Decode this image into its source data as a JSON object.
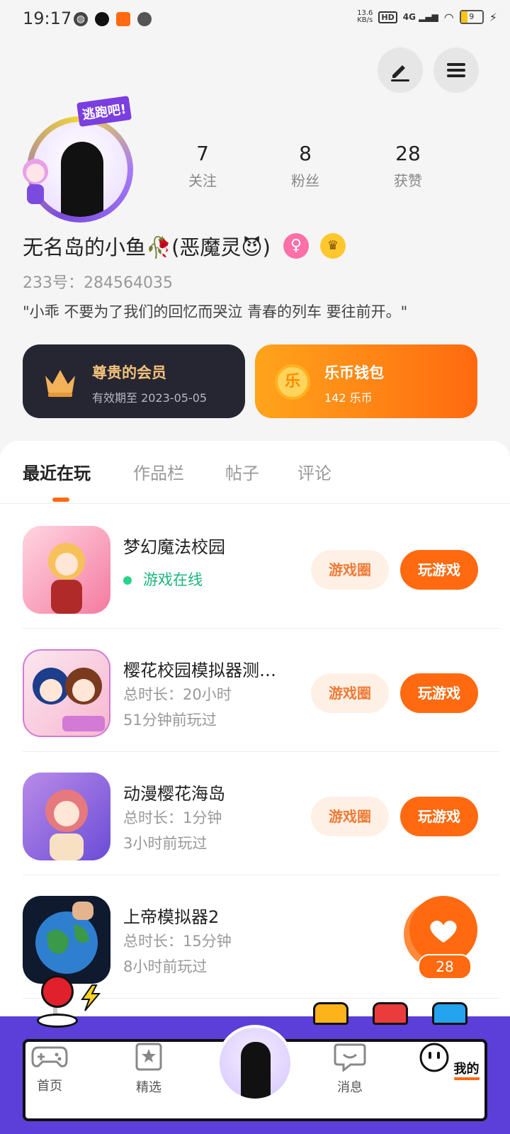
{
  "status_bar": {
    "time": "19:17",
    "net_speed": "13.6",
    "net_unit": "KB/s",
    "hd": "HD",
    "signal": "4G",
    "battery": "9"
  },
  "profile": {
    "badge_text": "逃跑吧!",
    "nickname": "无名岛的小鱼🥀(恶魔灵😈)",
    "uid_label": "233号：284564035",
    "signature": "\"小乖  不要为了我们的回忆而哭泣  青春的列车  要往前开。\"",
    "stats": [
      {
        "value": "7",
        "label": "关注"
      },
      {
        "value": "8",
        "label": "粉丝"
      },
      {
        "value": "28",
        "label": "获赞"
      }
    ]
  },
  "cards": {
    "vip": {
      "title": "尊贵的会员",
      "subtitle": "有效期至  2023-05-05"
    },
    "wallet": {
      "icon_char": "乐",
      "title": "乐币钱包",
      "subtitle": "142  乐币"
    }
  },
  "tabs": [
    "最近在玩",
    "作品栏",
    "帖子",
    "评论"
  ],
  "games": [
    {
      "name": "梦幻魔法校园",
      "line1": "游戏在线",
      "line2": "",
      "circle_label": "游戏圈",
      "play_label": "玩游戏"
    },
    {
      "name": "樱花校园模拟器测…",
      "line1": "总时长：20小时",
      "line2": "51分钟前玩过",
      "circle_label": "游戏圈",
      "play_label": "玩游戏"
    },
    {
      "name": "动漫樱花海岛",
      "line1": "总时长：1分钟",
      "line2": "3小时前玩过",
      "circle_label": "游戏圈",
      "play_label": "玩游戏"
    },
    {
      "name": "上帝模拟器2",
      "line1": "总时长：15分钟",
      "line2": "8小时前玩过"
    }
  ],
  "like_count": "28",
  "nav": {
    "home": "首页",
    "featured": "精选",
    "messages": "消息",
    "mine": "我的"
  },
  "colors": {
    "accent": "#ff6a10",
    "online": "#19b57c",
    "bar": "#5b3fd8"
  }
}
